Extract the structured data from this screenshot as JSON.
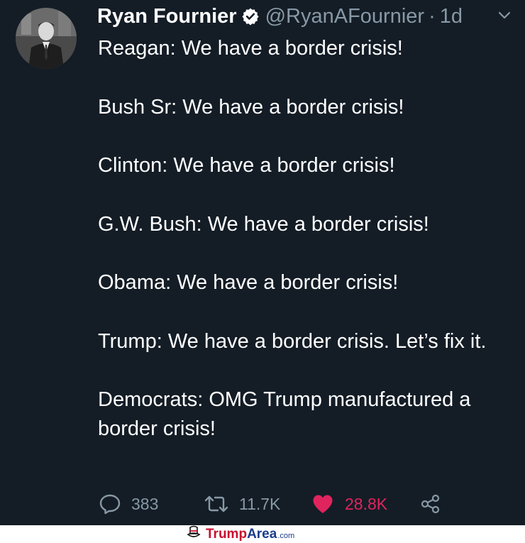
{
  "user": {
    "name": "Ryan Fournier",
    "handle": "@RyanAFournier",
    "separator": "·",
    "time": "1d",
    "verified": true
  },
  "tweet": {
    "paragraphs": [
      "Reagan: We have a border crisis!",
      "Bush Sr: We have a border crisis!",
      "Clinton: We have a border crisis!",
      "G.W. Bush: We have a border crisis!",
      "Obama: We have a border crisis!",
      "Trump: We have a border crisis. Let’s fix it.",
      "Democrats: OMG Trump manufactured a border crisis!"
    ]
  },
  "actions": {
    "replies": "383",
    "retweets": "11.7K",
    "likes": "28.8K"
  },
  "watermark": {
    "brand_red": "Trump",
    "brand_blue": "Area",
    "tld": ".com"
  },
  "colors": {
    "background": "#141d26",
    "text": "#ffffff",
    "muted": "#8899a6",
    "like": "#e0245e",
    "verified": "#ffffff"
  },
  "icons": [
    "chevron-down-icon",
    "verified-badge-icon",
    "reply-icon",
    "retweet-icon",
    "heart-icon",
    "share-icon",
    "hat-logo-icon"
  ]
}
